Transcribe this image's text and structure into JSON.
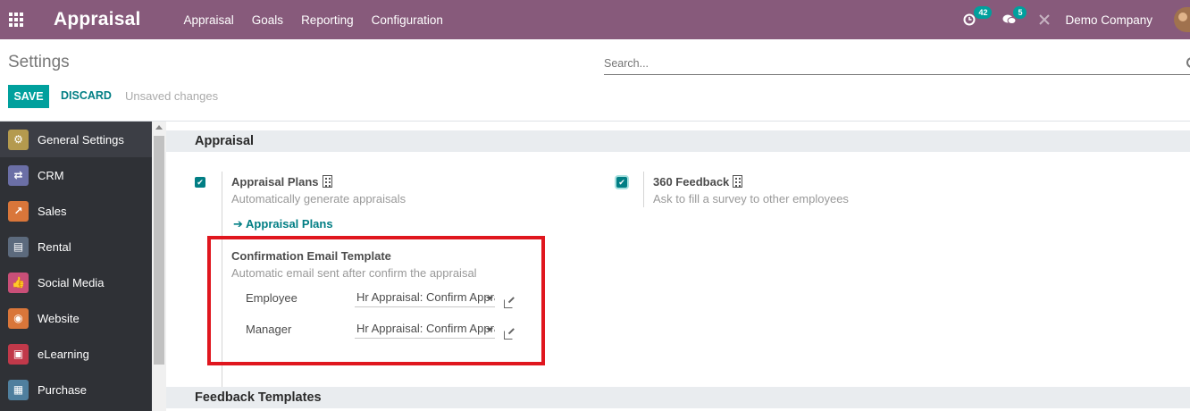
{
  "navbar": {
    "app_name": "Appraisal",
    "menu": [
      "Appraisal",
      "Goals",
      "Reporting",
      "Configuration"
    ],
    "activity_count": "42",
    "messages_count": "5",
    "company": "Demo Company"
  },
  "control_panel": {
    "title": "Settings",
    "search_placeholder": "Search...",
    "save_label": "SAVE",
    "discard_label": "DISCARD",
    "unsaved_text": "Unsaved changes"
  },
  "sidebar": {
    "items": [
      {
        "label": "General Settings",
        "icon": "gear-icon",
        "color": "#b49a4e"
      },
      {
        "label": "CRM",
        "icon": "handshake-icon",
        "color": "#6b6fa6"
      },
      {
        "label": "Sales",
        "icon": "chart-icon",
        "color": "#d9763a"
      },
      {
        "label": "Rental",
        "icon": "rental-icon",
        "color": "#5c6a7d"
      },
      {
        "label": "Social Media",
        "icon": "thumbs-up-icon",
        "color": "#c94f78"
      },
      {
        "label": "Website",
        "icon": "globe-icon",
        "color": "#d9763a"
      },
      {
        "label": "eLearning",
        "icon": "elearning-icon",
        "color": "#c1394a"
      },
      {
        "label": "Purchase",
        "icon": "purchase-icon",
        "color": "#4f7f9e"
      }
    ]
  },
  "content": {
    "section_appraisal": "Appraisal",
    "appraisal_plans": {
      "title": "Appraisal Plans",
      "description": "Automatically generate appraisals",
      "link_label": "Appraisal Plans",
      "checked": true
    },
    "feedback_360": {
      "title": "360 Feedback",
      "description": "Ask to fill a survey to other employees",
      "checked": true
    },
    "confirmation_email": {
      "title": "Confirmation Email Template",
      "description": "Automatic email sent after confirm the appraisal",
      "employee_label": "Employee",
      "employee_value": "Hr Appraisal: Confirm Appraisal",
      "manager_label": "Manager",
      "manager_value": "Hr Appraisal: Confirm Appraisal"
    },
    "section_feedback_templates": "Feedback Templates"
  },
  "colors": {
    "navbar": "#875a7b",
    "primary": "#00a09d",
    "link": "#017e84",
    "highlight": "#e0161e"
  }
}
